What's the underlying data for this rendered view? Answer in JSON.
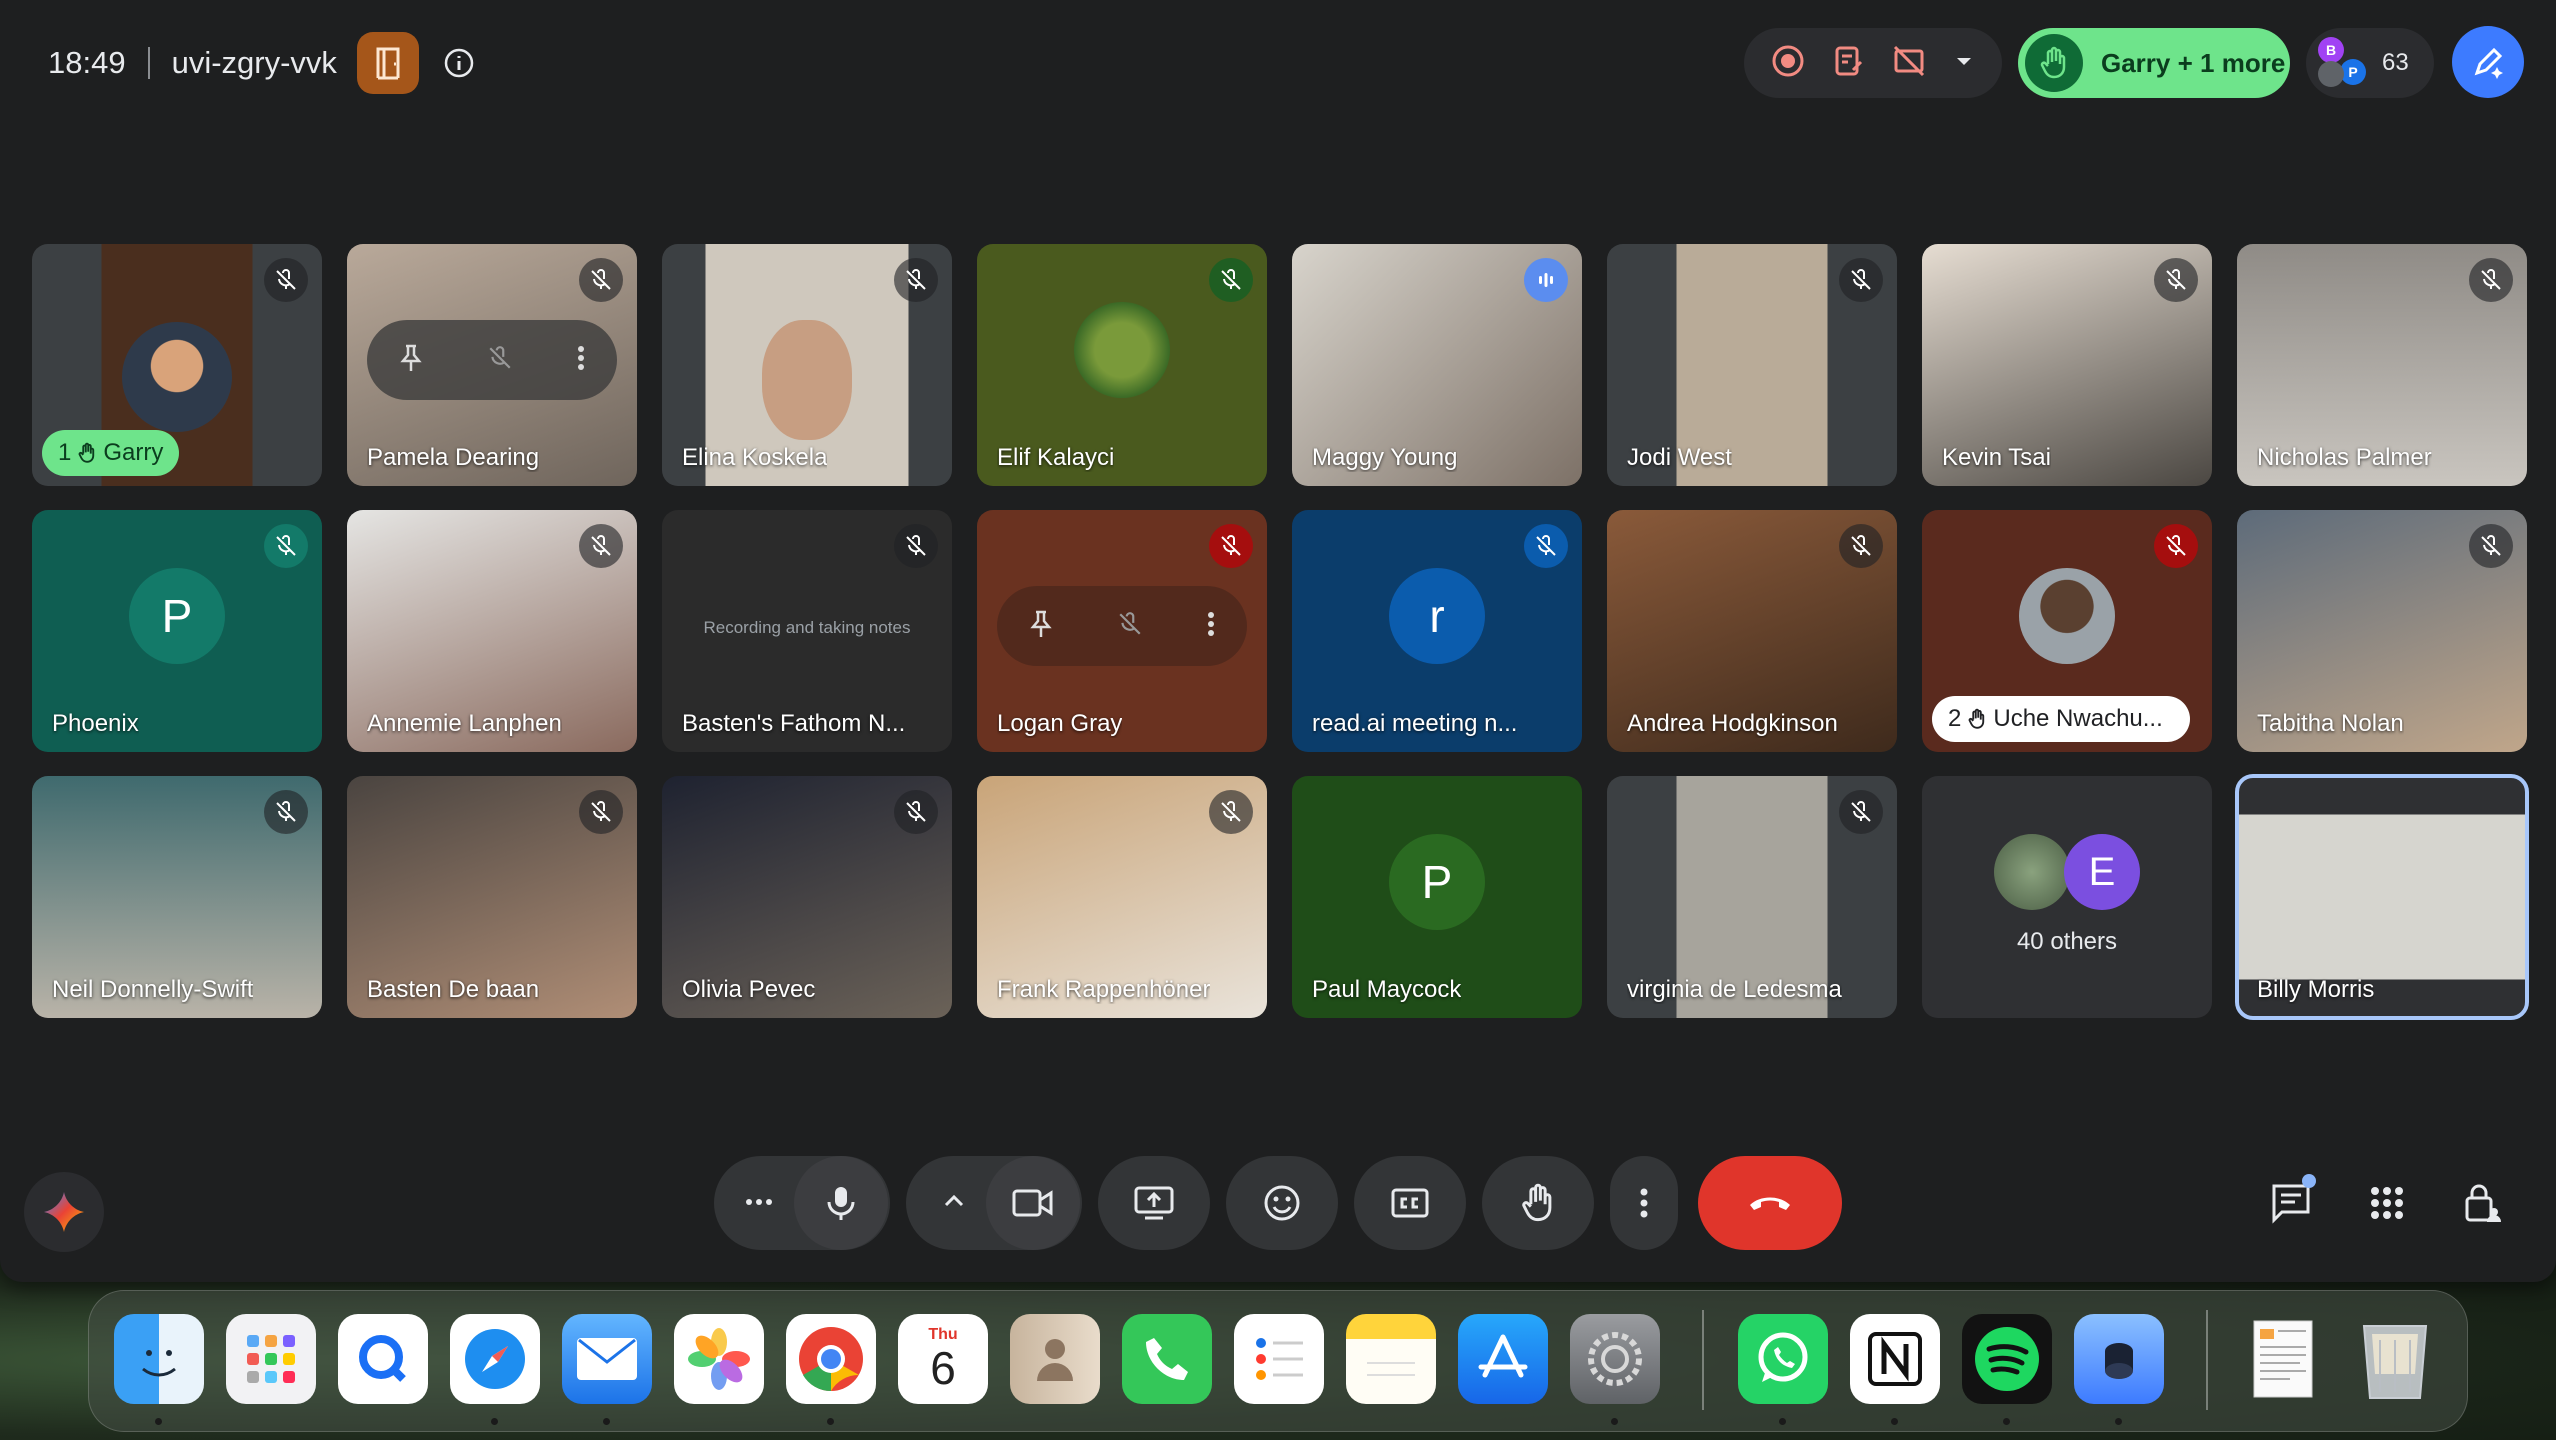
{
  "meeting": {
    "time": "18:49",
    "code": "uvi-zgry-vvk"
  },
  "top_bar": {
    "raised_hands_label": "Garry + 1 more",
    "participant_count": "63",
    "people_initials": [
      "B",
      "P"
    ]
  },
  "tiles": [
    {
      "name": "Garry",
      "hand": "1",
      "mic": "muted"
    },
    {
      "name": "Pamela Dearing",
      "mic": "muted"
    },
    {
      "name": "Elina Koskela",
      "mic": "muted"
    },
    {
      "name": "Elif Kalayci",
      "mic": "muted"
    },
    {
      "name": "Maggy Young",
      "mic": "speaking"
    },
    {
      "name": "Jodi West",
      "mic": "muted"
    },
    {
      "name": "Kevin Tsai",
      "mic": "muted"
    },
    {
      "name": "Nicholas Palmer",
      "mic": "muted"
    },
    {
      "name": "Phoenix",
      "initial": "P",
      "mic": "muted"
    },
    {
      "name": "Annemie Lanphen",
      "mic": "muted"
    },
    {
      "name": "Basten's Fathom N...",
      "note": "Recording and taking notes",
      "mic": "muted"
    },
    {
      "name": "Logan Gray",
      "mic": "muted"
    },
    {
      "name": "read.ai meeting n...",
      "initial": "r",
      "mic": "muted"
    },
    {
      "name": "Andrea Hodgkinson",
      "mic": "muted"
    },
    {
      "name": "Uche Nwachu...",
      "hand": "2",
      "mic": "muted"
    },
    {
      "name": "Tabitha Nolan",
      "mic": "muted"
    },
    {
      "name": "Neil Donnelly-Swift",
      "mic": "muted"
    },
    {
      "name": "Basten De baan",
      "mic": "muted"
    },
    {
      "name": "Olivia Pevec",
      "mic": "muted"
    },
    {
      "name": "Frank Rappenhöner",
      "mic": "muted"
    },
    {
      "name": "Paul Maycock",
      "initial": "P"
    },
    {
      "name": "virginia de Ledesma",
      "mic": "muted"
    },
    {
      "name": "40 others",
      "initial": "E"
    },
    {
      "name": "Billy Morris"
    }
  ],
  "colors": {
    "accent_green": "#6ee48b",
    "end_call_red": "#e0352b",
    "selected_outline": "#a8c7fa",
    "edit_blue": "#3d7bff"
  },
  "dock": {
    "calendar_month": "Thu",
    "calendar_day": "6",
    "apps": [
      "finder-icon",
      "launchpad-icon",
      "quicklook-icon",
      "safari-icon",
      "mail-icon",
      "photos-icon",
      "chrome-icon",
      "calendar-icon",
      "contacts-icon",
      "phone-icon",
      "reminders-icon",
      "notes-icon",
      "app-store-icon",
      "system-settings-icon",
      "whatsapp-icon",
      "notion-icon",
      "spotify-icon",
      "app-icon",
      "document-icon",
      "trash-icon"
    ]
  }
}
